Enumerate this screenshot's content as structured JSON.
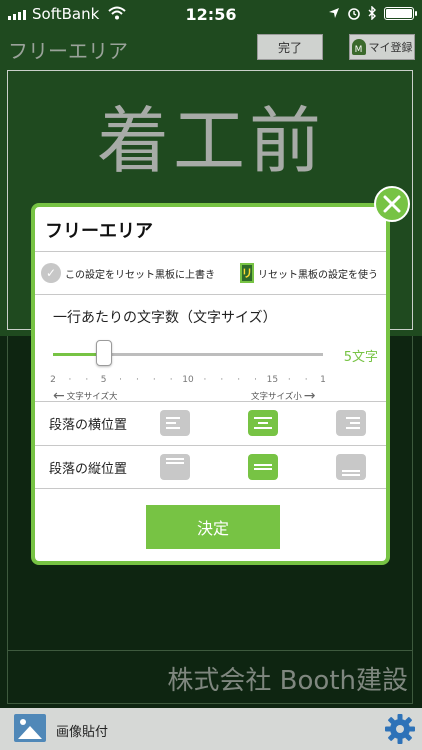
{
  "status_bar": {
    "carrier": "SoftBank",
    "time": "12:56"
  },
  "nav": {
    "title": "フリーエリア",
    "done_label": "完了",
    "my_register_label": "マイ登録",
    "my_badge": "M"
  },
  "board": {
    "heading": "着工前",
    "company": "株式会社 Booth建設"
  },
  "modal": {
    "title": "フリーエリア",
    "option_overwrite": "この設定をリセット黒板に上書き",
    "option_reset_badge": "リ",
    "option_use_reset": "リセット黒板の設定を使う",
    "slider_title": "一行あたりの文字数（文字サイズ）",
    "slider_value_label": "5文字",
    "slider": {
      "value": 5,
      "min": 2,
      "max": 18
    },
    "ticks": [
      "2",
      "5",
      "10",
      "15",
      "1"
    ],
    "size_big_label": "文字サイズ大",
    "size_small_label": "文字サイズ小",
    "horizontal_label": "段落の横位置",
    "horizontal_selected": "center",
    "vertical_label": "段落の縦位置",
    "vertical_selected": "middle",
    "confirm_label": "決定"
  },
  "bottom_bar": {
    "image_paste_label": "画像貼付"
  },
  "colors": {
    "accent": "#77c344",
    "board_green": "#1f4a1f"
  },
  "icons": [
    "signal-icon",
    "wifi-icon",
    "location-icon",
    "alarm-icon",
    "bluetooth-icon",
    "battery-icon",
    "check-icon",
    "close-icon",
    "image-icon",
    "gear-icon"
  ]
}
